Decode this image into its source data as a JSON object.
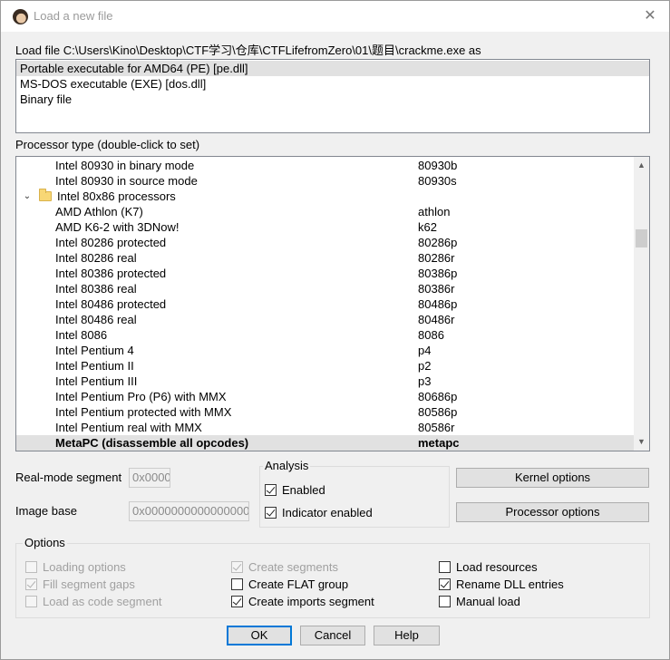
{
  "window": {
    "title": "Load a new file",
    "close_glyph": "✕"
  },
  "load_file_label": "Load file C:\\Users\\Kino\\Desktop\\CTF学习\\仓库\\CTFLifefromZero\\01\\题目\\crackme.exe as",
  "file_types": [
    {
      "label": "Portable executable for AMD64 (PE) [pe.dll]",
      "selected": true
    },
    {
      "label": "MS-DOS executable (EXE) [dos.dll]",
      "selected": false
    },
    {
      "label": "Binary file",
      "selected": false
    }
  ],
  "processor_label": "Processor type (double-click to set)",
  "processors": [
    {
      "name": "Intel 80930 in binary mode",
      "code": "80930b"
    },
    {
      "name": "Intel 80930 in source mode",
      "code": "80930s"
    },
    {
      "name": "Intel 80x86 processors",
      "code": "",
      "group": true
    },
    {
      "name": "AMD Athlon (K7)",
      "code": "athlon"
    },
    {
      "name": "AMD K6-2 with 3DNow!",
      "code": "k62"
    },
    {
      "name": "Intel 80286 protected",
      "code": "80286p"
    },
    {
      "name": "Intel 80286 real",
      "code": "80286r"
    },
    {
      "name": "Intel 80386 protected",
      "code": "80386p"
    },
    {
      "name": "Intel 80386 real",
      "code": "80386r"
    },
    {
      "name": "Intel 80486 protected",
      "code": "80486p"
    },
    {
      "name": "Intel 80486 real",
      "code": "80486r"
    },
    {
      "name": "Intel 8086",
      "code": "8086"
    },
    {
      "name": "Intel Pentium 4",
      "code": "p4"
    },
    {
      "name": "Intel Pentium II",
      "code": "p2"
    },
    {
      "name": "Intel Pentium III",
      "code": "p3"
    },
    {
      "name": "Intel Pentium Pro (P6) with MMX",
      "code": "80686p"
    },
    {
      "name": "Intel Pentium protected with MMX",
      "code": "80586p"
    },
    {
      "name": "Intel Pentium real with MMX",
      "code": "80586r"
    },
    {
      "name": "MetaPC (disassemble all opcodes)",
      "code": "metapc",
      "selected": true
    }
  ],
  "scroll": {
    "up": "▲",
    "down": "▼"
  },
  "group_expand_glyph": "⌄",
  "real_mode_segment": {
    "label": "Real-mode segment",
    "value": "0x0000"
  },
  "image_base": {
    "label": "Image base",
    "value": "0x0000000000000000"
  },
  "analysis": {
    "title": "Analysis",
    "enabled": {
      "label": "Enabled",
      "checked": true
    },
    "indicator": {
      "label": "Indicator enabled",
      "checked": true
    }
  },
  "buttons": {
    "kernel_options": "Kernel options",
    "processor_options": "Processor options",
    "ok": "OK",
    "cancel": "Cancel",
    "help": "Help"
  },
  "options": {
    "title": "Options",
    "loading_options": {
      "label": "Loading options",
      "checked": false,
      "disabled": true
    },
    "fill_segment_gaps": {
      "label": "Fill segment gaps",
      "checked": true,
      "disabled": true
    },
    "load_as_code_segment": {
      "label": "Load as code segment",
      "checked": false,
      "disabled": true
    },
    "create_segments": {
      "label": "Create segments",
      "checked": true,
      "disabled": true
    },
    "create_flat_group": {
      "label": "Create FLAT group",
      "checked": false,
      "disabled": false
    },
    "create_imports_segment": {
      "label": "Create imports segment",
      "checked": true,
      "disabled": false
    },
    "load_resources": {
      "label": "Load resources",
      "checked": false,
      "disabled": false
    },
    "rename_dll_entries": {
      "label": "Rename DLL entries",
      "checked": true,
      "disabled": false
    },
    "manual_load": {
      "label": "Manual load",
      "checked": false,
      "disabled": false
    }
  }
}
